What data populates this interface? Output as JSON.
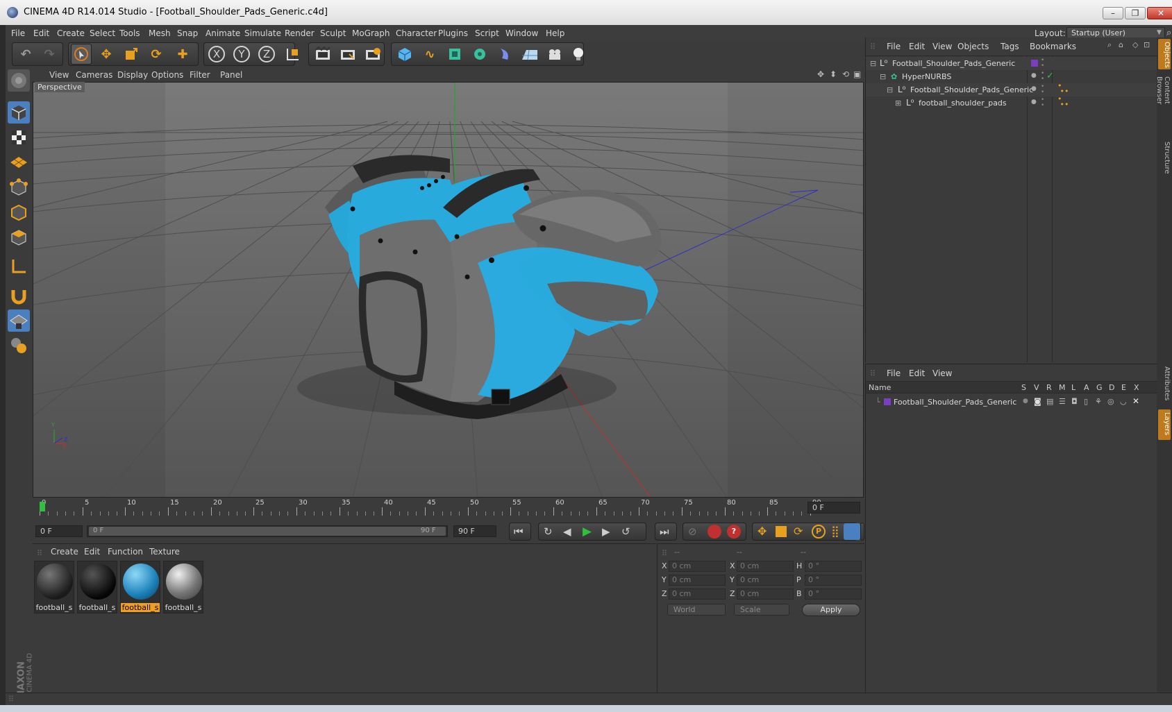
{
  "window": {
    "title": "CINEMA 4D R14.014 Studio - [Football_Shoulder_Pads_Generic.c4d]",
    "layout_label": "Layout:",
    "layout_value": "Startup (User)"
  },
  "menubar": [
    "File",
    "Edit",
    "Create",
    "Select",
    "Tools",
    "Mesh",
    "Snap",
    "Animate",
    "Simulate",
    "Render",
    "Sculpt",
    "MoGraph",
    "Character",
    "Plugins",
    "Script",
    "Window",
    "Help"
  ],
  "toolbar": {
    "axis_x": "X",
    "axis_y": "Y",
    "axis_z": "Z"
  },
  "viewport": {
    "menu": [
      "View",
      "Cameras",
      "Display",
      "Options",
      "Filter",
      "Panel"
    ],
    "label": "Perspective",
    "axis_y": "Y",
    "axis_x": "X",
    "axis_z": "Z"
  },
  "timeline": {
    "ticks": [
      "0",
      "5",
      "10",
      "15",
      "20",
      "25",
      "30",
      "35",
      "40",
      "45",
      "50",
      "55",
      "60",
      "65",
      "70",
      "75",
      "80",
      "85",
      "90"
    ],
    "current_frame": "0 F",
    "start_field": "0 F",
    "range_start": "0 F",
    "range_end": "90 F",
    "end_field": "90 F"
  },
  "material_manager": {
    "menu": [
      "Create",
      "Edit",
      "Function",
      "Texture"
    ],
    "materials": [
      {
        "label": "football_s",
        "selected": false
      },
      {
        "label": "football_s",
        "selected": false
      },
      {
        "label": "football_s",
        "selected": true
      },
      {
        "label": "football_s",
        "selected": false
      }
    ]
  },
  "coordinates": {
    "headers": [
      "--",
      "--",
      "--"
    ],
    "rows": [
      {
        "a": "X",
        "av": "0 cm",
        "b": "X",
        "bv": "0 cm",
        "c": "H",
        "cv": "0 °"
      },
      {
        "a": "Y",
        "av": "0 cm",
        "b": "Y",
        "bv": "0 cm",
        "c": "P",
        "cv": "0 °"
      },
      {
        "a": "Z",
        "av": "0 cm",
        "b": "Z",
        "bv": "0 cm",
        "c": "B",
        "cv": "0 °"
      }
    ],
    "mode": "World",
    "scale": "Scale",
    "apply": "Apply"
  },
  "object_manager": {
    "menu": [
      "File",
      "Edit",
      "View",
      "Objects",
      "Tags",
      "Bookmarks"
    ],
    "objects": [
      {
        "name": "Football_Shoulder_Pads_Generic",
        "indent": 0
      },
      {
        "name": "HyperNURBS",
        "indent": 1
      },
      {
        "name": "Football_Shoulder_Pads_Generic",
        "indent": 2
      },
      {
        "name": "football_shoulder_pads",
        "indent": 3
      }
    ]
  },
  "layer_manager": {
    "menu": [
      "File",
      "Edit",
      "View"
    ],
    "columns": [
      "Name",
      "S",
      "V",
      "R",
      "M",
      "L",
      "A",
      "G",
      "D",
      "E",
      "X"
    ],
    "layers": [
      {
        "name": "Football_Shoulder_Pads_Generic"
      }
    ]
  },
  "right_tabs": [
    "Objects",
    "Content Browser",
    "Structure",
    "Attributes",
    "Layers"
  ],
  "branding": {
    "maxon": "MAXON",
    "product": "CINEMA 4D"
  }
}
